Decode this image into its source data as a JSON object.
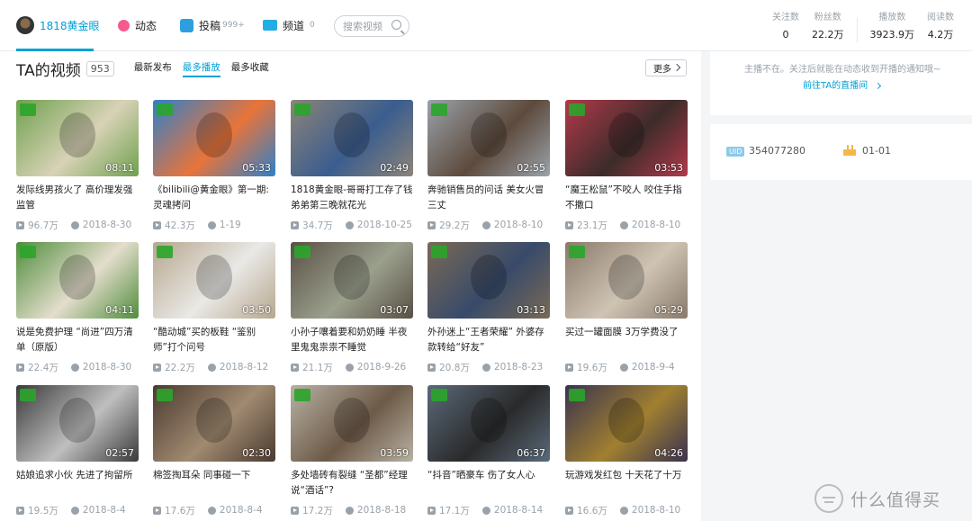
{
  "nav": {
    "home_label": "1818黄金眼",
    "dynamics_label": "动态",
    "posts_label": "投稿",
    "posts_count": "999+",
    "channels_label": "频道",
    "channels_count": "0",
    "search_placeholder": "搜索视频"
  },
  "stats": [
    {
      "label": "关注数",
      "value": "0"
    },
    {
      "label": "粉丝数",
      "value": "22.2万"
    },
    {
      "label": "播放数",
      "value": "3923.9万"
    },
    {
      "label": "阅读数",
      "value": "4.2万"
    }
  ],
  "section": {
    "title": "TA的视频",
    "count": "953",
    "tabs": [
      "最新发布",
      "最多播放",
      "最多收藏"
    ],
    "active_tab": "最多播放",
    "more_label": "更多"
  },
  "videos": [
    {
      "title": "发际线男孩火了 高价理发强监管",
      "duration": "08:11",
      "plays": "96.7万",
      "date": "2018-8-30",
      "palette": [
        "#6fa14e",
        "#d8d2b6"
      ]
    },
    {
      "title": "《bilibili@黄金眼》第一期: 灵魂拷问",
      "duration": "05:33",
      "plays": "42.3万",
      "date": "1-19",
      "palette": [
        "#2f80c9",
        "#e8743a"
      ]
    },
    {
      "title": "1818黄金眼-哥哥打工存了钱 弟弟第三晚就花光",
      "duration": "02:49",
      "plays": "34.7万",
      "date": "2018-10-25",
      "palette": [
        "#8d8478",
        "#3a5d8f"
      ]
    },
    {
      "title": "奔驰销售员的问话 美女火冒三丈",
      "duration": "02:55",
      "plays": "29.2万",
      "date": "2018-8-10",
      "palette": [
        "#9aa3ab",
        "#5d4a3c"
      ]
    },
    {
      "title": "“魔王松鼠”不咬人 咬住手指不撒口",
      "duration": "03:53",
      "plays": "23.1万",
      "date": "2018-8-10",
      "palette": [
        "#b3394a",
        "#3c2c2a"
      ]
    },
    {
      "title": "说是免费护理 “尚进”四万清单（原版）",
      "duration": "04:11",
      "plays": "22.4万",
      "date": "2018-8-30",
      "palette": [
        "#4f8d3c",
        "#e4ddcc"
      ]
    },
    {
      "title": "“酷动城”买的板鞋 “鉴别师”打个问号",
      "duration": "03:50",
      "plays": "22.2万",
      "date": "2018-8-12",
      "palette": [
        "#b7a68e",
        "#e9e9e6"
      ]
    },
    {
      "title": "小孙子嚷着要和奶奶睡 半夜里鬼鬼祟祟不睡觉",
      "duration": "03:07",
      "plays": "21.1万",
      "date": "2018-9-26",
      "palette": [
        "#5a5046",
        "#9aa08c"
      ]
    },
    {
      "title": "外孙迷上“王者荣耀” 外婆存款转给“好友”",
      "duration": "03:13",
      "plays": "20.8万",
      "date": "2018-8-23",
      "palette": [
        "#7a6a55",
        "#384a6a"
      ]
    },
    {
      "title": "买过一罐面膜 3万学费没了",
      "duration": "05:29",
      "plays": "19.6万",
      "date": "2018-9-4",
      "palette": [
        "#8a7a6a",
        "#cfc4b4"
      ]
    },
    {
      "title": "姑娘追求小伙 先进了拘留所",
      "duration": "02:57",
      "plays": "19.5万",
      "date": "2018-8-4",
      "palette": [
        "#3a3a3a",
        "#bfbfbf"
      ]
    },
    {
      "title": "棉签掏耳朵 同事碰一下",
      "duration": "02:30",
      "plays": "17.6万",
      "date": "2018-8-4",
      "palette": [
        "#4a3a30",
        "#a08a70"
      ]
    },
    {
      "title": "多处墙砖有裂缝 “圣都”经理说“酒话”?",
      "duration": "03:59",
      "plays": "17.2万",
      "date": "2018-8-18",
      "palette": [
        "#b8b2a4",
        "#6d5a48"
      ]
    },
    {
      "title": "“抖音”晒豪车 伤了女人心",
      "duration": "06:37",
      "plays": "17.1万",
      "date": "2018-8-14",
      "palette": [
        "#5a6a7a",
        "#2a2a2a"
      ]
    },
    {
      "title": "玩游戏发红包 十天花了十万",
      "duration": "04:26",
      "plays": "16.6万",
      "date": "2018-8-10",
      "palette": [
        "#3a3250",
        "#a08030"
      ]
    }
  ],
  "side": {
    "notice": "主播不在。关注后就能在动态收到开播的通知哦~",
    "live_link": "前往TA的直播间",
    "uid_badge": "UID",
    "uid": "354077280",
    "birthday": "01-01"
  },
  "watermark": "什么值得买"
}
